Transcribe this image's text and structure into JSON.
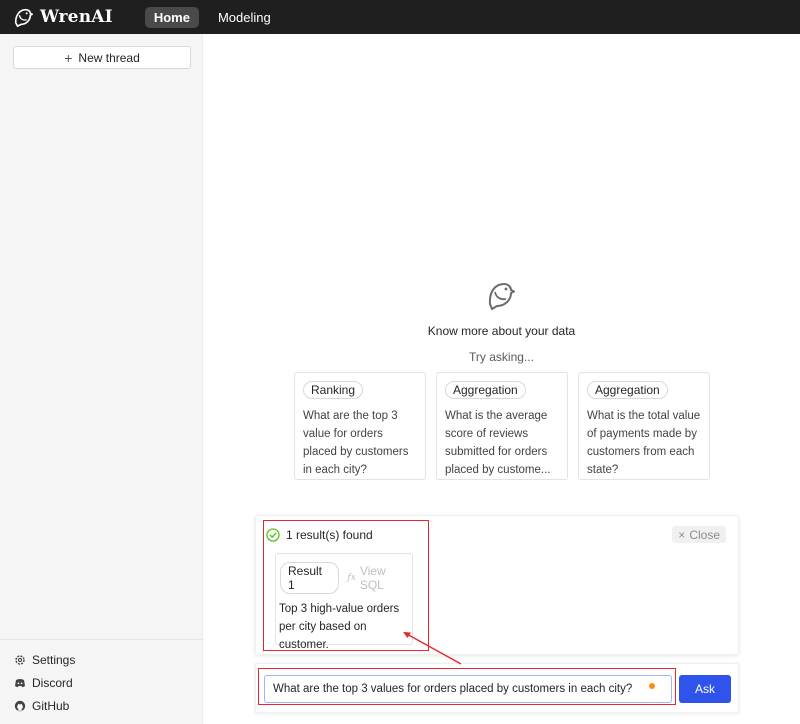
{
  "app": {
    "name": "WrenAI"
  },
  "nav": {
    "home": "Home",
    "modeling": "Modeling"
  },
  "sidebar": {
    "new_thread": "New thread",
    "links": [
      {
        "label": "Settings",
        "icon": "gear-icon"
      },
      {
        "label": "Discord",
        "icon": "discord-icon"
      },
      {
        "label": "GitHub",
        "icon": "github-icon"
      }
    ]
  },
  "main": {
    "title": "Know more about your data",
    "subtitle": "Try asking...",
    "suggestions": [
      {
        "tag": "Ranking",
        "text": "What are the top 3 value for orders placed by customers in each city?"
      },
      {
        "tag": "Aggregation",
        "text": "What is the average score of reviews submitted for orders placed by custome..."
      },
      {
        "tag": "Aggregation",
        "text": "What is the total value of payments made by customers from each state?"
      }
    ]
  },
  "result_panel": {
    "status": "1 result(s) found",
    "close_label": "Close",
    "result": {
      "tag": "Result 1",
      "view_sql": "View SQL",
      "fx": "fx",
      "text": "Top 3 high-value orders per city based on customer."
    }
  },
  "ask": {
    "input_value": "What are the top 3 values for orders placed by customers in each city?",
    "button": "Ask"
  },
  "colors": {
    "accent": "#2f54eb",
    "highlight": "#e8262e",
    "success": "#52c41a",
    "topbar": "#1f1f1f"
  }
}
